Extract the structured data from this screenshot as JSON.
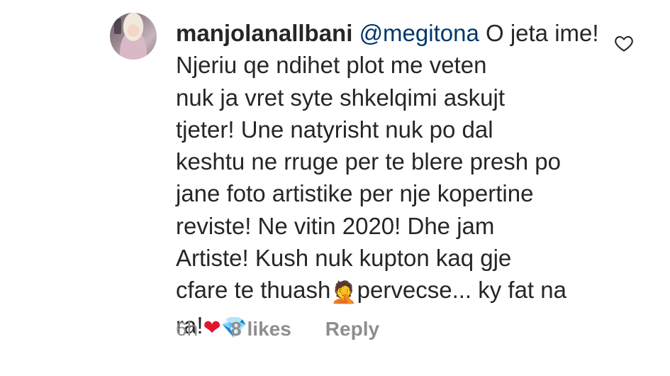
{
  "comment": {
    "username": "manjolanallbani",
    "mention": "@megitona",
    "text_part1": " O jeta ime! Njeriu qe ndihet plot me veten\nnuk ja vret syte shkelqimi askujt\ntjeter! Une natyrisht nuk po dal\nkeshtu ne rruge per te blere presh po\njane foto artistike per nje kopertine\nreviste! Ne vitin 2020! Dhe jam\nArtiste! Kush nuk kupton kaq gje\ncfare te thuash",
    "emoji_facepalm": "🤦",
    "text_part2": "pervecse... ky fat na\nra!",
    "emoji_heart": "❤",
    "emoji_gem": "💎",
    "time": "6h",
    "likes": "8 likes",
    "reply": "Reply"
  },
  "icons": {
    "like": "heart-outline-icon",
    "avatar": "profile-avatar"
  },
  "colors": {
    "text": "#262626",
    "mention": "#00376b",
    "meta": "#8e8e8e",
    "heart_emoji": "#e0162b",
    "gem_emoji": "#4fc3f7"
  }
}
